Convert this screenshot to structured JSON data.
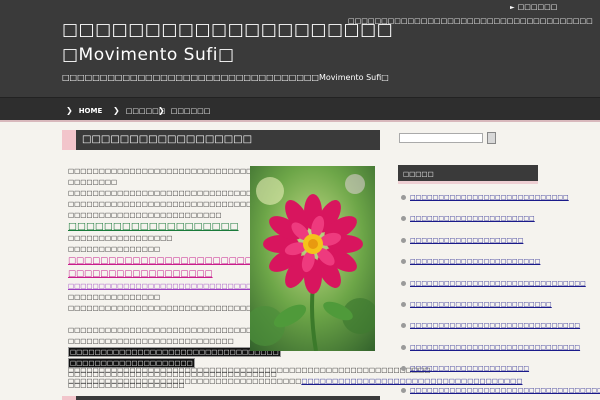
{
  "header": {
    "site_title_line1": "□□□□□□□□□□□□□□□□□□□□",
    "site_title_line2": "□Movimento Sufi□",
    "site_description": "□□□□□□□□□□□□□□□□□□□□□□□□□□□□□□□□□□Movimento Sufi□",
    "header_note": "□□□□□□□□□□□□□□□□□□□□□□□□□□□□□□□□□□□□□",
    "header_link": "□□□□□□"
  },
  "nav": {
    "items": [
      {
        "label": "HOME"
      },
      {
        "label": "□□□□□□"
      },
      {
        "label": "□□□□□□"
      }
    ]
  },
  "post": {
    "title": "□□□□□□□□□□□□□□□□□□",
    "para1_line1": "□□□□□□□□□□□□□□□□□□□□□□□□□□□□□□□□□□",
    "para1_line2": "□□□□□□□□",
    "para2_line1": "□□□□□□□□□□□□□□□□□□□□□□□□□□□□□□□□□□",
    "para2_line2": "□□□□□□□□□□□□□□□□□□□□□□□□□□□□□□□□□□",
    "para2_line3": "□□□□□□□□□□□□□□□□□□□□□□□□□",
    "link_green": "□□□□□□□□□□□□□□□□□□□",
    "after_green_line1": "□□□□□□□□□□□□□□□□□",
    "after_green_line2": "□□□□□□□□□□□□□□□",
    "link_magenta_line1": "□□□□□□□□□□□□□□□□□□□□□□□□□□□□",
    "link_magenta_line2": "□□□□□□□□□□□□□□□□□□",
    "link_purple": "□□□□□□□□□□□□□□□□□□□□□□□□□□□□□□□□□□",
    "after_purple_line1": "□□□□□□□□□□□□□□□",
    "after_purple_line2": "□□□□□□□□□□□□□□□□□□□□□□□□□□□□□□",
    "para3_line1": "□□□□□□□□□□□□□□□□□□□□□□□□□□□□□□□□□□",
    "para3_line2": "□□□□□□□□□□□□□□□□□□□□□□□□□□□",
    "boxed_line1": "□□□□□□□□□□□□□□□□□□□□□□□□□□□□□□□□□□",
    "boxed_line2": "□□□□□□□□□□□□□□□□□□□□",
    "para4_line1": "□□□□□□□□□□□□□□□□□□□□□□□□□□□□□□□□□□",
    "para4_line2": "□□□□□□□□□□□□□□□□□□□",
    "wide_line1": "□□□□□□□□□□□□□□□□□□□□□□□□□□□□□□□□□□□□□□□□□□□□□□□□□□□□□□□□□□□",
    "wide_line2_text": "□□□□□□□□□□□□□□□□□□□□□□□□□□□□□□□□□□□□□□",
    "wide_line2_link": "□□□□□□□□□□□□□□□□□□□□□□□□□□□□□□□□□□□□"
  },
  "sidebar": {
    "search_placeholder": "",
    "widget_title": "□□□□□",
    "items": [
      {
        "label": "□□□□□□□□□□□□□□□□□□□□□□□□□□□□"
      },
      {
        "label": "□□□□□□□□□□□□□□□□□□□□□□"
      },
      {
        "label": "□□□□□□□□□□□□□□□□□□□□"
      },
      {
        "label": "□□□□□□□□□□□□□□□□□□□□□□□"
      },
      {
        "label": "□□□□□□□□□□□□□□□□□□□□□□□□□□□□□□□"
      },
      {
        "label": "□□□□□□□□□□□□□□□□□□□□□□□□□"
      },
      {
        "label": "□□□□□□□□□□□□□□□□□□□□□□□□□□□□□□"
      },
      {
        "label": "□□□□□□□□□□□□□□□□□□□□□□□□□□□□□□"
      },
      {
        "label": "□□□□□□□□□□□□□□□□□□□□□"
      },
      {
        "label": "□□□□□□□□□□□□□□□□□□□□□□□□□□□□□□□□□□□□□"
      }
    ]
  },
  "colors": {
    "header_bg": "#3a3a3a",
    "accent_pink": "#f2c5cb",
    "link_green": "#1a7a3a",
    "link_magenta": "#c81c8c",
    "link_purple": "#9b3fc0",
    "page_bg": "#f5f3ee"
  },
  "icons": {
    "nav_chevron": "chevron-right-icon",
    "header_arrow": "triangle-right-icon",
    "list_bullet": "circle-bullet-icon"
  }
}
